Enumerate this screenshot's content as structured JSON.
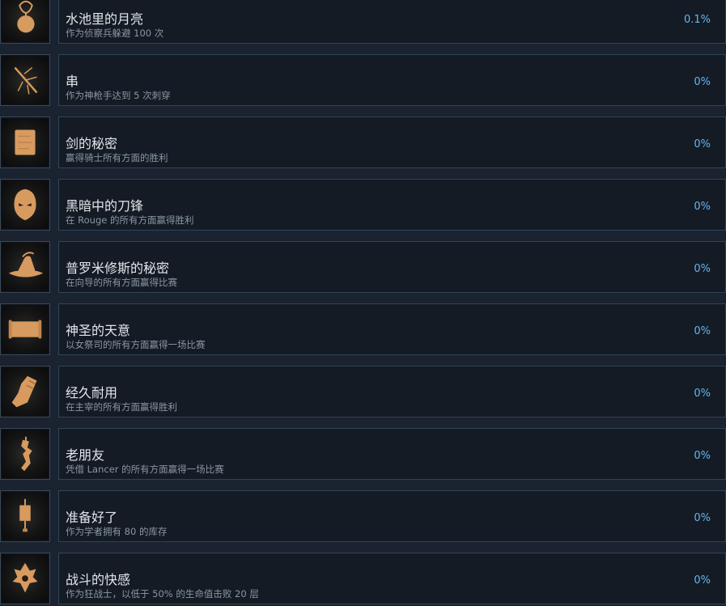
{
  "colors": {
    "background": "#1b2230",
    "card": "#141b25",
    "card_border": "#2e4655",
    "icon_fill": "#d79a5f",
    "title_text": "#e2e6ea",
    "desc_text": "#8a97a3",
    "percent_text": "#67b5f0"
  },
  "achievements": [
    {
      "icon": "moon-pendant-icon",
      "title": "水池里的月亮",
      "desc": "作为侦察兵躲避 100 次",
      "percent": "0.1%"
    },
    {
      "icon": "spear-burst-icon",
      "title": "串",
      "desc": "作为神枪手达到 5 次刺穿",
      "percent": "0%"
    },
    {
      "icon": "scroll-page-icon",
      "title": "剑的秘密",
      "desc": "赢得骑士所有方面的胜利",
      "percent": "0%"
    },
    {
      "icon": "mask-icon",
      "title": "黑暗中的刀锋",
      "desc": "在 Rouge 的所有方面赢得胜利",
      "percent": "0%"
    },
    {
      "icon": "wizard-hat-icon",
      "title": "普罗米修斯的秘密",
      "desc": "在向导的所有方面赢得比赛",
      "percent": "0%"
    },
    {
      "icon": "scroll-banner-icon",
      "title": "神圣的天意",
      "desc": "以女祭司的所有方面赢得一场比赛",
      "percent": "0%"
    },
    {
      "icon": "gauntlet-icon",
      "title": "经久耐用",
      "desc": "在主宰的所有方面赢得胜利",
      "percent": "0%"
    },
    {
      "icon": "lance-figure-icon",
      "title": "老朋友",
      "desc": "凭借 Lancer 的所有方面赢得一场比赛",
      "percent": "0%"
    },
    {
      "icon": "hanging-scroll-icon",
      "title": "准备好了",
      "desc": "作为学者拥有 80 的库存",
      "percent": "0%"
    },
    {
      "icon": "berserker-crest-icon",
      "title": "战斗的快感",
      "desc": "作为狂战士，以低于 50% 的生命值击败 20 层",
      "percent": "0%"
    }
  ]
}
